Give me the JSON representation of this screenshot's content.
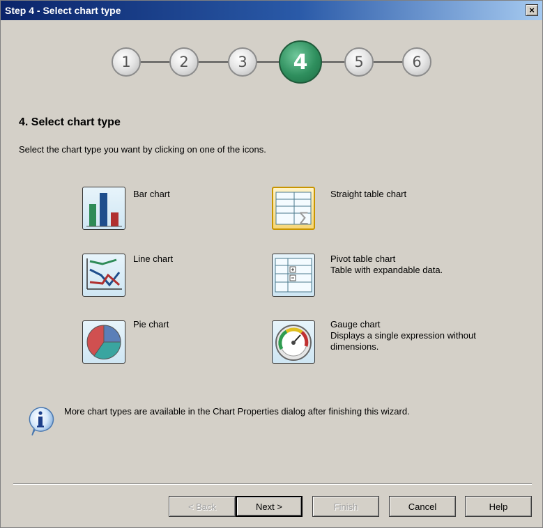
{
  "window": {
    "title": "Step 4 - Select chart type",
    "close_glyph": "×"
  },
  "steps": [
    {
      "label": "1",
      "active": false
    },
    {
      "label": "2",
      "active": false
    },
    {
      "label": "3",
      "active": false
    },
    {
      "label": "4",
      "active": true
    },
    {
      "label": "5",
      "active": false
    },
    {
      "label": "6",
      "active": false
    }
  ],
  "heading": "4. Select chart type",
  "instruction": "Select the chart type you want by clicking on one of the icons.",
  "chart_types": {
    "bar": {
      "label": "Bar chart",
      "icon": "bar-chart-icon"
    },
    "straight": {
      "label": "Straight table chart",
      "icon": "straight-table-icon",
      "selected": true
    },
    "line": {
      "label": "Line chart",
      "icon": "line-chart-icon"
    },
    "pivot": {
      "label": "Pivot table chart",
      "description": "Table with expandable data.",
      "icon": "pivot-table-icon"
    },
    "pie": {
      "label": "Pie chart",
      "icon": "pie-chart-icon"
    },
    "gauge": {
      "label": "Gauge chart",
      "description_line1": "Displays a single expression without",
      "description_line2": "dimensions.",
      "icon": "gauge-chart-icon"
    }
  },
  "info": {
    "text": "More chart types are available in the Chart Properties dialog after finishing this wizard.",
    "icon": "info-icon"
  },
  "buttons": {
    "back": {
      "label": "< Back",
      "enabled": false
    },
    "next": {
      "label": "Next >",
      "enabled": true
    },
    "finish": {
      "label": "Finish",
      "enabled": false
    },
    "cancel": {
      "label": "Cancel",
      "enabled": true
    },
    "help": {
      "label": "Help",
      "enabled": true
    }
  },
  "colors": {
    "titlebar": "#0a246a",
    "active_step": "#2f8f5e",
    "dialog_bg": "#d4d0c8"
  }
}
